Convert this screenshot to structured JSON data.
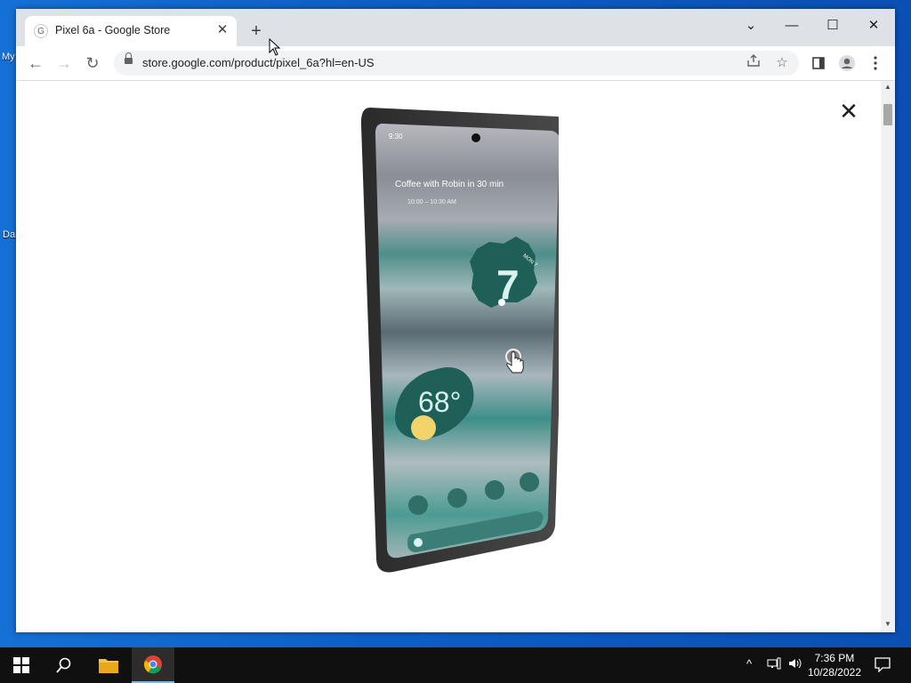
{
  "browser": {
    "tab": {
      "title": "Pixel 6a - Google Store",
      "favicon": "G"
    },
    "address": {
      "url": "store.google.com/product/pixel_6a?hl=en-US"
    }
  },
  "icons": {
    "new_tab": "+",
    "close": "✕",
    "back": "←",
    "forward": "→",
    "reload": "↻",
    "minimize": "—",
    "maximize": "☐",
    "tab_search": "⌄"
  },
  "phone_screen": {
    "status_time": "9:30",
    "event": "Coffee with Robin in 30 min",
    "event_detail": "10:00 – 10:30 AM",
    "clock_digit": "7",
    "clock_label": "MON 7",
    "weather": "68°"
  },
  "taskbar": {
    "time": "7:36 PM",
    "date": "10/28/2022"
  },
  "colors": {
    "tabstrip": "#dee1e6",
    "accent_blue": "#1a73e8",
    "taskbar": "#101010",
    "widget_teal": "#1e5f57"
  }
}
